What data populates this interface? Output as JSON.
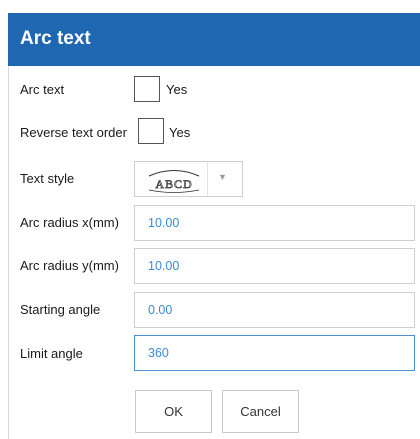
{
  "dialog": {
    "title": "Arc text"
  },
  "fields": {
    "arc_text": {
      "label": "Arc text",
      "checkbox_label": "Yes"
    },
    "reverse_order": {
      "label": "Reverse text order",
      "checkbox_label": "Yes"
    },
    "text_style": {
      "label": "Text style",
      "preview_text": "ABCD"
    },
    "arc_radius_x": {
      "label": "Arc radius x(mm)",
      "value": "10.00"
    },
    "arc_radius_y": {
      "label": "Arc radius y(mm)",
      "value": "10.00"
    },
    "starting_angle": {
      "label": "Starting angle",
      "value": "0.00"
    },
    "limit_angle": {
      "label": "Limit angle",
      "value": "360"
    }
  },
  "buttons": {
    "ok": "OK",
    "cancel": "Cancel"
  },
  "colors": {
    "title_bar": "#1f67b1",
    "value_text": "#3b8ad8",
    "focus_border": "#4a8fd6"
  }
}
